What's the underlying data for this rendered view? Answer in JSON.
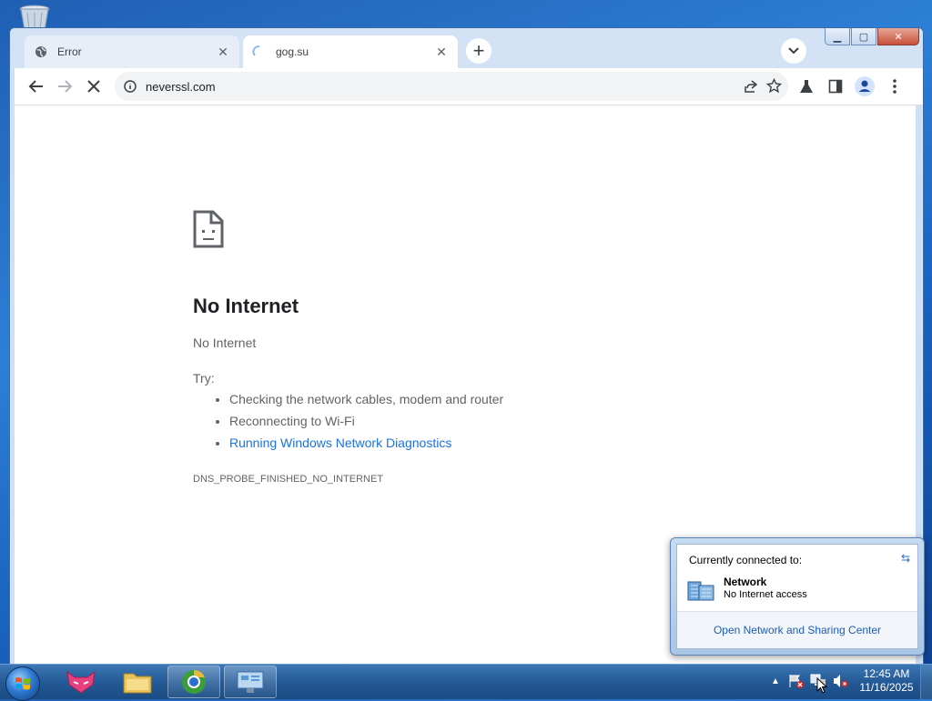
{
  "browser": {
    "tabs": [
      {
        "label": "Error",
        "icon": "globe-icon"
      },
      {
        "label": "gog.su",
        "icon": "loading-spinner-icon"
      }
    ],
    "address": "neverssl.com"
  },
  "error_page": {
    "title": "No Internet",
    "subtitle": "No Internet",
    "try_label": "Try:",
    "suggestions": [
      "Checking the network cables, modem and router",
      "Reconnecting to Wi-Fi",
      "Running Windows Network Diagnostics"
    ],
    "error_code": "DNS_PROBE_FINISHED_NO_INTERNET"
  },
  "network_flyout": {
    "header": "Currently connected to:",
    "network_name": "Network",
    "network_status": "No Internet access",
    "footer_link": "Open Network and Sharing Center"
  },
  "taskbar": {
    "time": "12:45 AM",
    "date": "11/16/2025"
  },
  "colors": {
    "link": "#1a73e8",
    "taskbar": "#245a96"
  }
}
